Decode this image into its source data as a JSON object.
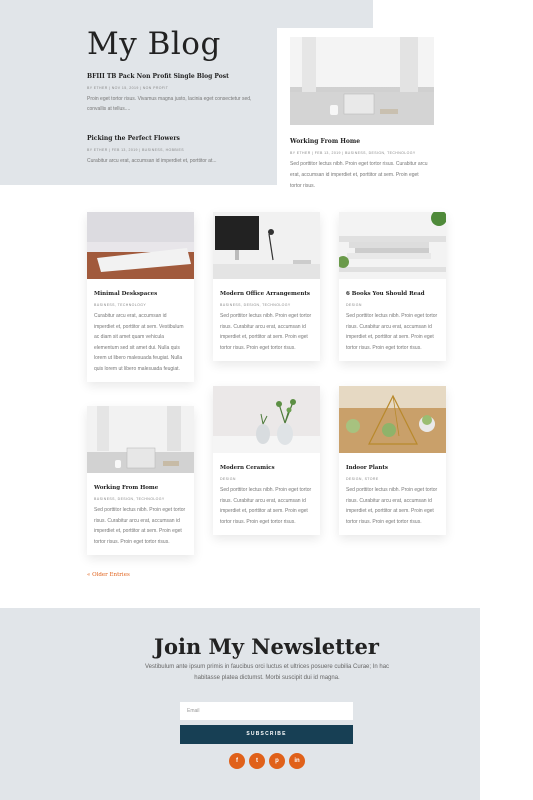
{
  "hero": {
    "title": "My Blog",
    "posts": [
      {
        "title": "BFIII TB Pack Non Profit Single Blog Post",
        "meta": "BY ETHER | NOV 15, 2019 | NON PROFIT",
        "excerpt": "Proin eget tortor risus. Vivamus magna justo, lacinia eget consectetur sed, convallis at tellus...."
      },
      {
        "title": "Picking the Perfect Flowers",
        "meta": "BY ETHER | FEB 13, 2019 | BUSINESS, HOBBIES",
        "excerpt": "Curabitur arcu erat, accumsan id imperdiet et, porttitor at..."
      }
    ]
  },
  "featured": {
    "title": "Working From Home",
    "meta": "BY ETHER | FEB 13, 2019 | BUSINESS, DESIGN, TECHNOLOGY",
    "excerpt": "Sed porttitor lectus nibh. Proin eget tortor risus. Curabitur arcu erat, accumsan id imperdiet et, porttitor at sem. Proin eget tortor risus."
  },
  "cards": [
    {
      "title": "Minimal Deskspaces",
      "meta": "BUSINESS, TECHNOLOGY",
      "excerpt": "Curabitur arcu erat, accumsan id imperdiet et, porttitor at sem. Vestibulum ac diam sit amet quam vehicula elementum sed sit amet dui. Nulla quis lorem ut libero malesuada feugiat. Nulla quis lorem ut libero malesuada feugiat."
    },
    {
      "title": "Modern Office Arrangements",
      "meta": "BUSINESS, DESIGN, TECHNOLOGY",
      "excerpt": "Sed porttitor lectus nibh. Proin eget tortor risus. Curabitur arcu erat, accumsan id imperdiet et, porttitor at sem. Proin eget tortor risus. Proin eget tortor risus."
    },
    {
      "title": "6 Books You Should Read",
      "meta": "DESIGN",
      "excerpt": "Sed porttitor lectus nibh. Proin eget tortor risus. Curabitur arcu erat, accumsan id imperdiet et, porttitor at sem. Proin eget tortor risus. Proin eget tortor risus."
    },
    {
      "title": "Working From Home",
      "meta": "BUSINESS, DESIGN, TECHNOLOGY",
      "excerpt": "Sed porttitor lectus nibh. Proin eget tortor risus. Curabitur arcu erat, accumsan id imperdiet et, porttitor at sem. Proin eget tortor risus. Proin eget tortor risus."
    },
    {
      "title": "Modern Ceramics",
      "meta": "DESIGN",
      "excerpt": "Sed porttitor lectus nibh. Proin eget tortor risus. Curabitur arcu erat, accumsan id imperdiet et, porttitor at sem. Proin eget tortor risus. Proin eget tortor risus."
    },
    {
      "title": "Indoor Plants",
      "meta": "DESIGN, STORE",
      "excerpt": "Sed porttitor lectus nibh. Proin eget tortor risus. Curabitur arcu erat, accumsan id imperdiet et, porttitor at sem. Proin eget tortor risus. Proin eget tortor risus."
    }
  ],
  "older_entries": "« Older Entries",
  "newsletter": {
    "title": "Join My Newsletter",
    "description": "Vestibulum ante ipsum primis in faucibus orci luctus et ultrices posuere cubilia Curae; In hac habitasse platea dictumst. Morbi suscipit dui id magna.",
    "email_placeholder": "Email",
    "button": "SUBSCRIBE"
  },
  "social": [
    {
      "icon": "facebook-icon",
      "glyph": "f"
    },
    {
      "icon": "twitter-icon",
      "glyph": "t"
    },
    {
      "icon": "pinterest-icon",
      "glyph": "p"
    },
    {
      "icon": "linkedin-icon",
      "glyph": "in"
    }
  ],
  "colors": {
    "accent": "#e0611a",
    "button": "#173f54",
    "section_bg": "#e1e5e9"
  }
}
